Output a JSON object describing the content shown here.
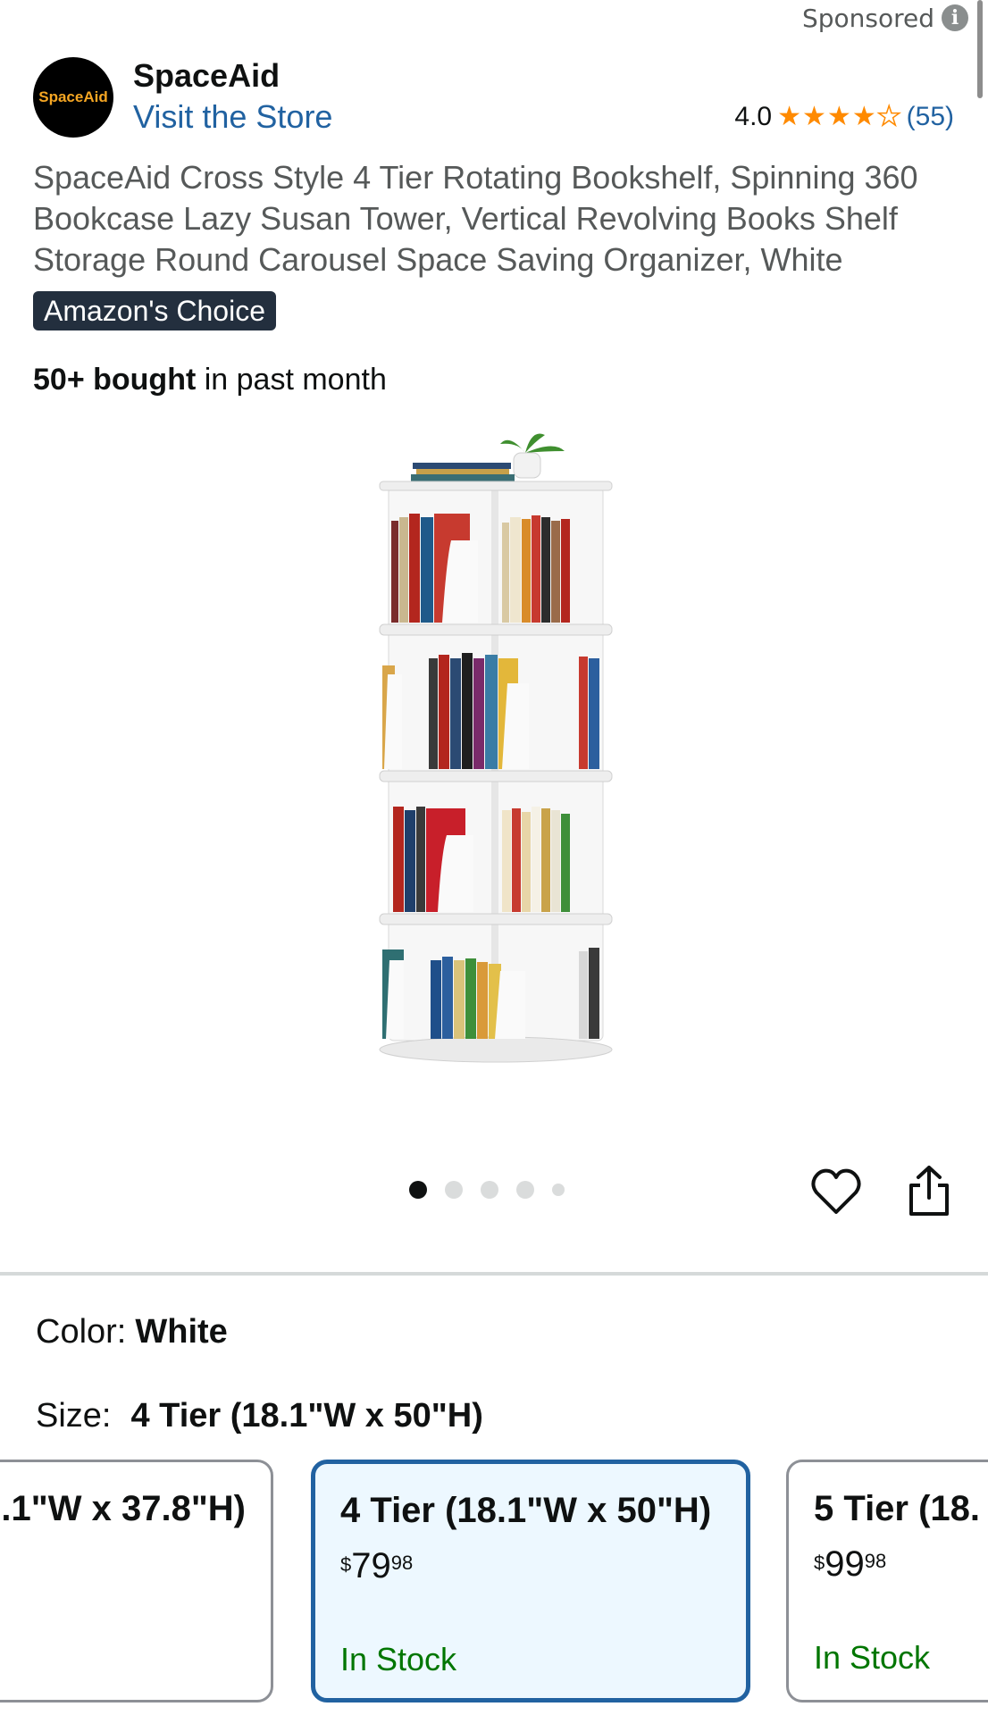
{
  "header": {
    "sponsored_label": "Sponsored",
    "info_icon_glyph": "i"
  },
  "brand": {
    "logo_text": "SpaceAid",
    "name": "SpaceAid",
    "store_link": "Visit the Store",
    "logo_color": "#f5a623"
  },
  "rating": {
    "value": "4.0",
    "stars": 4.0,
    "count": "(55)",
    "star_color": "#ff8a00"
  },
  "product": {
    "title": "SpaceAid Cross Style 4 Tier Rotating Bookshelf, Spinning 360 Bookcase Lazy Susan Tower, Vertical Revolving Books Shelf Storage Round Carousel Space Saving Organizer, White",
    "badge": "Amazon's Choice",
    "bought_bold": "50+ bought",
    "bought_rest": " in past month"
  },
  "gallery": {
    "image_count": 5,
    "active_index": 0,
    "image_icon": "rotating-bookshelf-image"
  },
  "actions": {
    "heart_icon": "heart-icon",
    "share_icon": "share-icon"
  },
  "variations": {
    "color_label": "Color:",
    "color_value": "White",
    "size_label": "Size:",
    "size_value": "4 Tier (18.1\"W x 50\"H)",
    "options": [
      {
        "title": ".1\"W x 37.8\"H)",
        "price_symbol": "",
        "price_whole": "",
        "price_fraction": "",
        "stock": "",
        "selected": false
      },
      {
        "title": "4 Tier (18.1\"W x 50\"H)",
        "price_symbol": "$",
        "price_whole": "79",
        "price_fraction": "98",
        "stock": "In Stock",
        "selected": true
      },
      {
        "title": "5 Tier (18.",
        "price_symbol": "$",
        "price_whole": "99",
        "price_fraction": "98",
        "stock": "In Stock",
        "selected": false
      }
    ]
  }
}
